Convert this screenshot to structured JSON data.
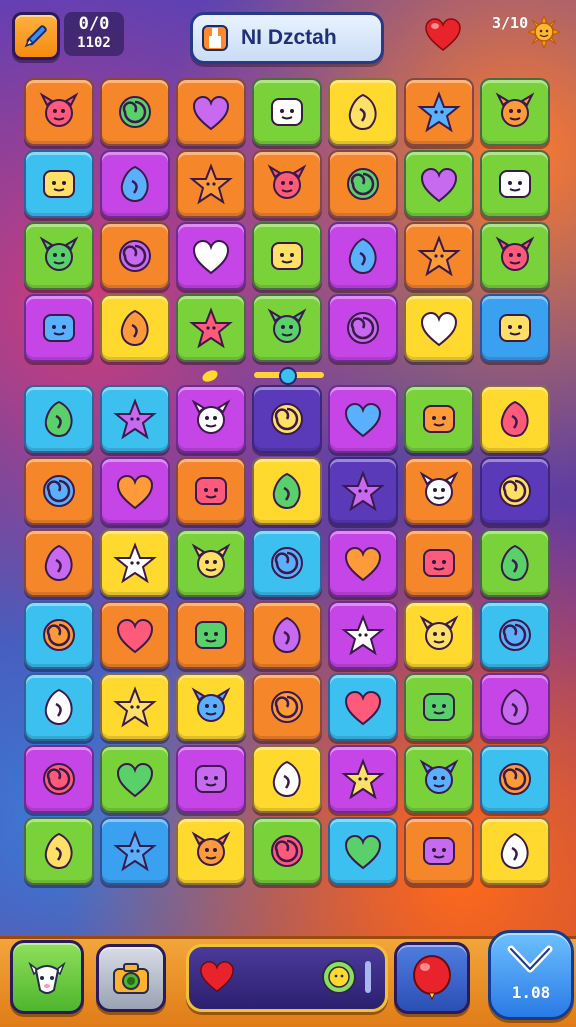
{
  "header": {
    "score_top": "0/0",
    "score_bottom": "1102",
    "title": "NI Dzctah",
    "coins": "3/10"
  },
  "board": {
    "upper_rows": [
      [
        "orange",
        "orange",
        "orange",
        "green",
        "yellow",
        "orange",
        "green"
      ],
      [
        "cyan",
        "purple",
        "orange",
        "orange",
        "orange",
        "green",
        "green"
      ],
      [
        "green",
        "orange",
        "purple",
        "green",
        "purple",
        "orange",
        "green"
      ],
      [
        "purple",
        "yellow",
        "green",
        "green",
        "purple",
        "yellow",
        "blue"
      ]
    ],
    "lower_rows": [
      [
        "cyan",
        "cyan",
        "purple",
        "indigo",
        "purple",
        "green",
        "yellow"
      ],
      [
        "orange",
        "purple",
        "orange",
        "yellow",
        "indigo",
        "orange",
        "indigo"
      ],
      [
        "orange",
        "yellow",
        "green",
        "cyan",
        "purple",
        "orange",
        "green"
      ],
      [
        "cyan",
        "orange",
        "orange",
        "orange",
        "purple",
        "yellow",
        "cyan"
      ],
      [
        "cyan",
        "yellow",
        "yellow",
        "orange",
        "cyan",
        "green",
        "purple"
      ],
      [
        "purple",
        "green",
        "purple",
        "yellow",
        "purple",
        "green",
        "cyan"
      ],
      [
        "green",
        "blue",
        "yellow",
        "green",
        "cyan",
        "orange",
        "yellow"
      ]
    ]
  },
  "bottom": {
    "counter": "1.08"
  },
  "colors": {
    "orange": "#f5862a",
    "yellow": "#ffd92e",
    "green": "#7ad23a",
    "cyan": "#3cc0f0",
    "purple": "#c545e6",
    "blue": "#3aa0f0",
    "indigo": "#5a3ab8"
  }
}
